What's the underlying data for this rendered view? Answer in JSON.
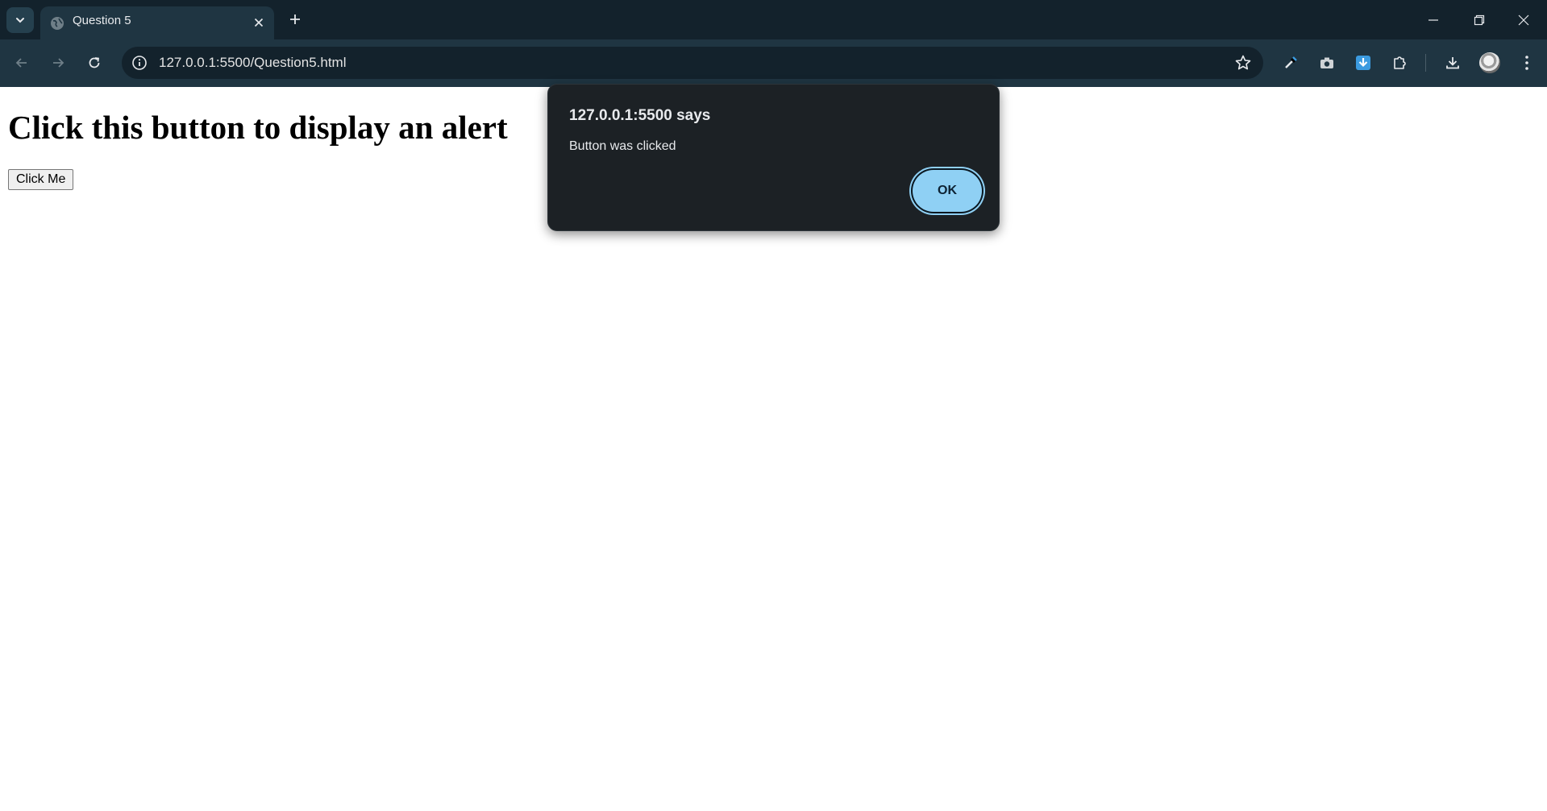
{
  "browser": {
    "tab": {
      "title": "Question 5"
    },
    "address_bar": {
      "url": "127.0.0.1:5500/Question5.html"
    },
    "colors": {
      "frame": "#13222c",
      "toolbar": "#1f3542",
      "download_ext": "#3b9be0"
    }
  },
  "page": {
    "heading": "Click this button to display an alert",
    "button_label": "Click Me"
  },
  "dialog": {
    "title": "127.0.0.1:5500 says",
    "message": "Button was clicked",
    "ok_label": "OK",
    "accent": "#8fd0f4"
  }
}
